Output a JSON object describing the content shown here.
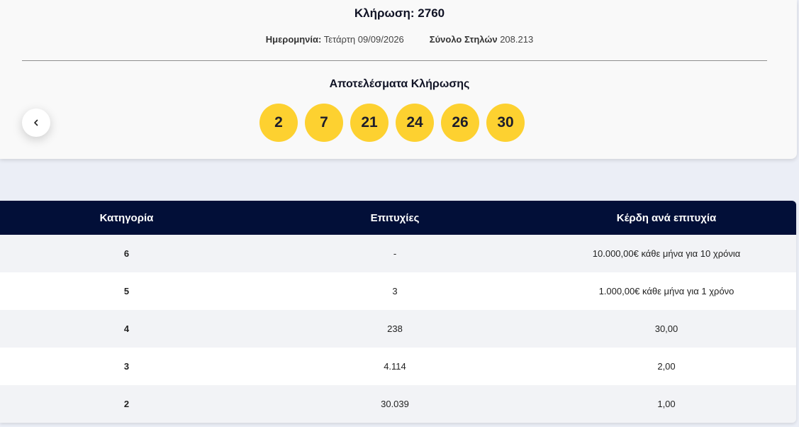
{
  "draw": {
    "title": "Κλήρωση: 2760",
    "date_label": "Ημερομηνία:",
    "date_value": "Τετάρτη 09/09/2026",
    "columns_label": "Σύνολο Στηλών",
    "columns_value": "208.213",
    "results_title": "Αποτελέσματα Κλήρωσης",
    "numbers": [
      "2",
      "7",
      "21",
      "24",
      "26",
      "30"
    ],
    "ball_color": "#fdd130"
  },
  "nav": {
    "prev_icon": "chevron-left-icon"
  },
  "table": {
    "header_color": "#020f38",
    "headers": [
      "Κατηγορία",
      "Επιτυχίες",
      "Κέρδη ανά επιτυχία"
    ],
    "rows": [
      {
        "category": "6",
        "winners": "-",
        "prize": "10.000,00€ κάθε μήνα για 10 χρόνια"
      },
      {
        "category": "5",
        "winners": "3",
        "prize": "1.000,00€ κάθε μήνα για 1 χρόνο"
      },
      {
        "category": "4",
        "winners": "238",
        "prize": "30,00"
      },
      {
        "category": "3",
        "winners": "4.114",
        "prize": "2,00"
      },
      {
        "category": "2",
        "winners": "30.039",
        "prize": "1,00"
      }
    ]
  }
}
